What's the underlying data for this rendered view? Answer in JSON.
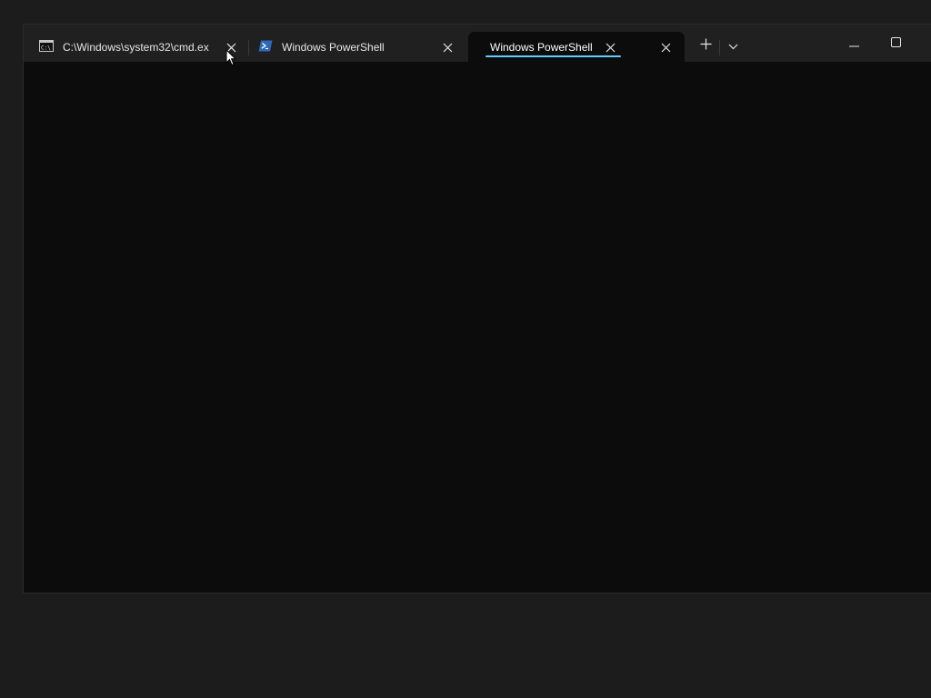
{
  "window": {
    "tabs": [
      {
        "label": "C:\\Windows\\system32\\cmd.ex",
        "icon": "cmd-icon",
        "active": false
      },
      {
        "label": "Windows PowerShell",
        "icon": "powershell-icon",
        "active": false
      },
      {
        "label": "Windows PowerShell",
        "icon": "",
        "active": true
      }
    ],
    "controls": {
      "new_tab_icon": "plus-icon",
      "dropdown_icon": "chevron-down-icon",
      "minimize_icon": "minimize-icon",
      "maximize_icon": "maximize-icon"
    }
  },
  "colors": {
    "titlebar": "#202020",
    "terminal_background": "#0c0c0c",
    "desktop": "#1c1c1c",
    "active_tab_underline": "#60cdff",
    "powershell_icon": "#2f68b8"
  }
}
